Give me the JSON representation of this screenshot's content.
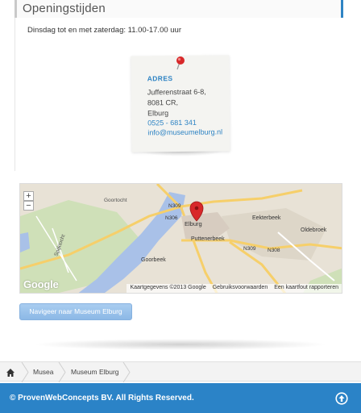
{
  "section": {
    "title": "Openingstijden"
  },
  "hours": {
    "text": "Dinsdag tot en met zaterdag: 11.00-17.00 uur"
  },
  "address": {
    "heading": "ADRES",
    "street": "Jufferenstraat 6-8,",
    "postal": "8081 CR,",
    "city": "Elburg",
    "phone": "0525 - 681 341",
    "email": "info@museumelburg.nl"
  },
  "map": {
    "zoom_in": "+",
    "zoom_out": "−",
    "labels": {
      "elburg": "Elburg",
      "eekterbeek": "Eekterbeek",
      "oldebroek": "Oldebroek",
      "puttenerbeek": "Puttenerbeek",
      "goorbeek": "Goorbeek",
      "goortocht": "Goortocht",
      "spijktocht": "Spijktocht",
      "n306": "N306",
      "n309a": "N309",
      "n309b": "N309",
      "n308": "N308"
    },
    "logo": "Google",
    "credits": {
      "data": "Kaartgegevens ©2013 Google",
      "terms": "Gebruiksvoorwaarden",
      "report": "Een kaartfout rapporteren"
    }
  },
  "navigate_button": {
    "label": "Navigeer naar Museum Elburg"
  },
  "breadcrumb": {
    "items": [
      "Musea",
      "Museum Elburg"
    ]
  },
  "footer": {
    "copyright": "© ProvenWebConcepts BV. All Rights Reserved."
  },
  "colors": {
    "accent": "#2b83c7",
    "link": "#2f84c4",
    "pin": "#d8282a"
  }
}
